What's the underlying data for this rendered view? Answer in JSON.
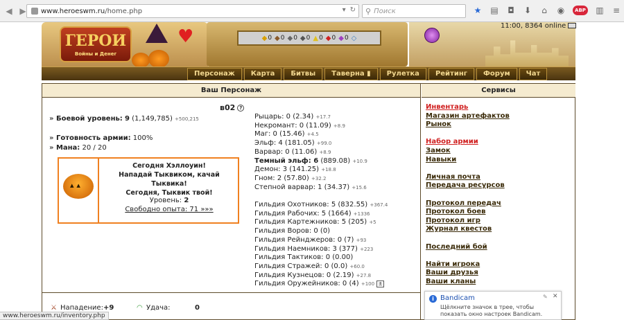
{
  "browser": {
    "url_domain": "www.heroeswm.ru",
    "url_path": "/home.php",
    "search_placeholder": "Поиск"
  },
  "header": {
    "logo_text": "ГЕРОИ",
    "logo_sub": "Войны и Денег",
    "clock": "11:00, 8364 online",
    "resources": [
      "0",
      "0",
      "0",
      "0",
      "0",
      "0",
      "0"
    ],
    "menu": [
      "Персонаж",
      "Карта",
      "Битвы",
      "Таверна",
      "Рулетка",
      "Рейтинг",
      "Форум",
      "Чат"
    ]
  },
  "left": {
    "title": "Ваш Персонаж",
    "char_name": "в02",
    "combat_label": "Боевой уровень:",
    "combat_level": "9",
    "combat_exp": "(1,149,785)",
    "combat_exp_small": "+500,215",
    "army_label": "Готовность армии:",
    "army_value": "100%",
    "mana_label": "Мана:",
    "mana_value": "20 / 20",
    "halloween": {
      "line1": "Сегодня Хэллоуин!",
      "line2": "Нападай Тыквиком, качай Тыквика!",
      "line3": "Сегодня, Тыквик твой!",
      "level_label": "Уровень:",
      "level_value": "2",
      "free_exp": "Свободно опыта: 71 »»»"
    },
    "factions": [
      {
        "text": "Рыцарь: 0 (2.34)",
        "small": "+17.7"
      },
      {
        "text": "Некромант: 0 (11.09)",
        "small": "+8.9"
      },
      {
        "text": "Маг: 0 (15.46)",
        "small": "+4.5"
      },
      {
        "text": "Эльф: 4 (181.05)",
        "small": "+99.0"
      },
      {
        "text": "Варвар: 0 (11.06)",
        "small": "+8.9"
      },
      {
        "text_bold": "Темный эльф: 6",
        "text": " (889.08)",
        "small": "+10.9"
      },
      {
        "text": "Демон: 3 (141.25)",
        "small": "+18.8"
      },
      {
        "text": "Гном: 2 (57.80)",
        "small": "+32.2"
      },
      {
        "text": "Степной варвар: 1 (34.37)",
        "small": "+15.6"
      }
    ],
    "guilds": [
      {
        "text": "Гильдия Охотников: 5 (832.55)",
        "small": "+367.4"
      },
      {
        "text": "Гильдия Рабочих: 5 (1664)",
        "small": "+1336"
      },
      {
        "text": "Гильдия Картежников: 5 (205)",
        "small": "+5"
      },
      {
        "text": "Гильдия Воров: 0 (0)",
        "small": ""
      },
      {
        "text": "Гильдия Рейнджеров: 0 (7)",
        "small": "+93"
      },
      {
        "text": "Гильдия Наемников: 3 (377)",
        "small": "+223"
      },
      {
        "text": "Гильдия Тактиков: 0 (0.00)",
        "small": ""
      },
      {
        "text": "Гильдия Стражей: 0 (0.0)",
        "small": "+60.0"
      },
      {
        "text": "Гильдия Кузнецов: 0 (2.19)",
        "small": "+27.8"
      },
      {
        "text": "Гильдия Оружейников: 0 (4)",
        "small": "+100"
      }
    ],
    "bottom": {
      "attack_label": "Нападение:",
      "attack_value": "+9",
      "luck_label": "Удача:",
      "luck_value": "0"
    }
  },
  "right": {
    "title": "Сервисы",
    "group1": [
      "Инвентарь",
      "Магазин артефактов",
      "Рынок"
    ],
    "group2": [
      "Набор армии",
      "Замок",
      "Навыки"
    ],
    "group3": [
      "Личная почта",
      "Передача ресурсов"
    ],
    "group4": [
      "Протокол передач",
      "Протокол боев",
      "Протокол игр",
      "Журнал квестов"
    ],
    "group5": [
      "Последний бой"
    ],
    "group6": [
      "Найти игрока",
      "Ваши друзья",
      "Ваши кланы"
    ]
  },
  "statusbar": "www.heroeswm.ru/inventory.php",
  "popup": {
    "title": "Bandicam",
    "body": "Щёлкните значок в трее, чтобы показать окно настроек Bandicam."
  }
}
